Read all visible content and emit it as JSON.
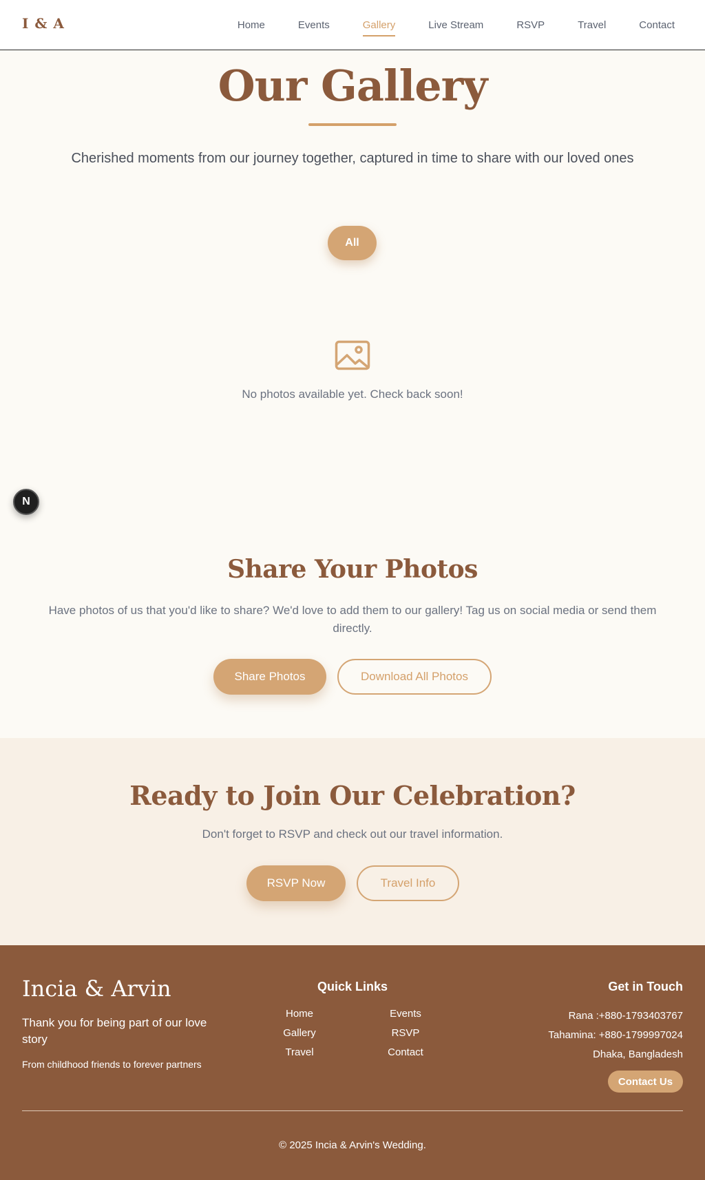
{
  "nav": {
    "logo": "I & A",
    "links": [
      "Home",
      "Events",
      "Gallery",
      "Live Stream",
      "RSVP",
      "Travel",
      "Contact"
    ],
    "active": "Gallery"
  },
  "gallery": {
    "title": "Our Gallery",
    "subtitle": "Cherished moments from our journey together, captured in time to share with our loved ones",
    "filter_all": "All",
    "empty_icon": "image-icon",
    "empty_text": "No photos available yet. Check back soon!"
  },
  "next_badge": "N",
  "share": {
    "title": "Share Your Photos",
    "description": "Have photos of us that you'd like to share? We'd love to add them to our gallery! Tag us on social media or send them directly.",
    "share_button": "Share Photos",
    "download_button": "Download All Photos"
  },
  "cta": {
    "title": "Ready to Join Our Celebration?",
    "description": "Don't forget to RSVP and check out our travel information.",
    "rsvp_button": "RSVP Now",
    "travel_button": "Travel Info"
  },
  "footer": {
    "brand": "Incia & Arvin",
    "tagline": "Thank you for being part of our love story",
    "note": "From childhood friends to forever partners",
    "quick_links_title": "Quick Links",
    "quick_links": [
      "Home",
      "Events",
      "Gallery",
      "RSVP",
      "Travel",
      "Contact"
    ],
    "contact_title": "Get in Touch",
    "contact_lines": [
      "Rana :+880-1793403767",
      "Tahamina: +880-1799997024",
      "Dhaka, Bangladesh"
    ],
    "contact_button": "Contact Us",
    "copyright": "© 2025 Incia & Arvin's Wedding."
  },
  "colors": {
    "brand_brown": "#8b5a3c",
    "accent_tan": "#d4a574",
    "background_cream": "#fcfaf5",
    "cta_background": "#f8f0e6"
  }
}
